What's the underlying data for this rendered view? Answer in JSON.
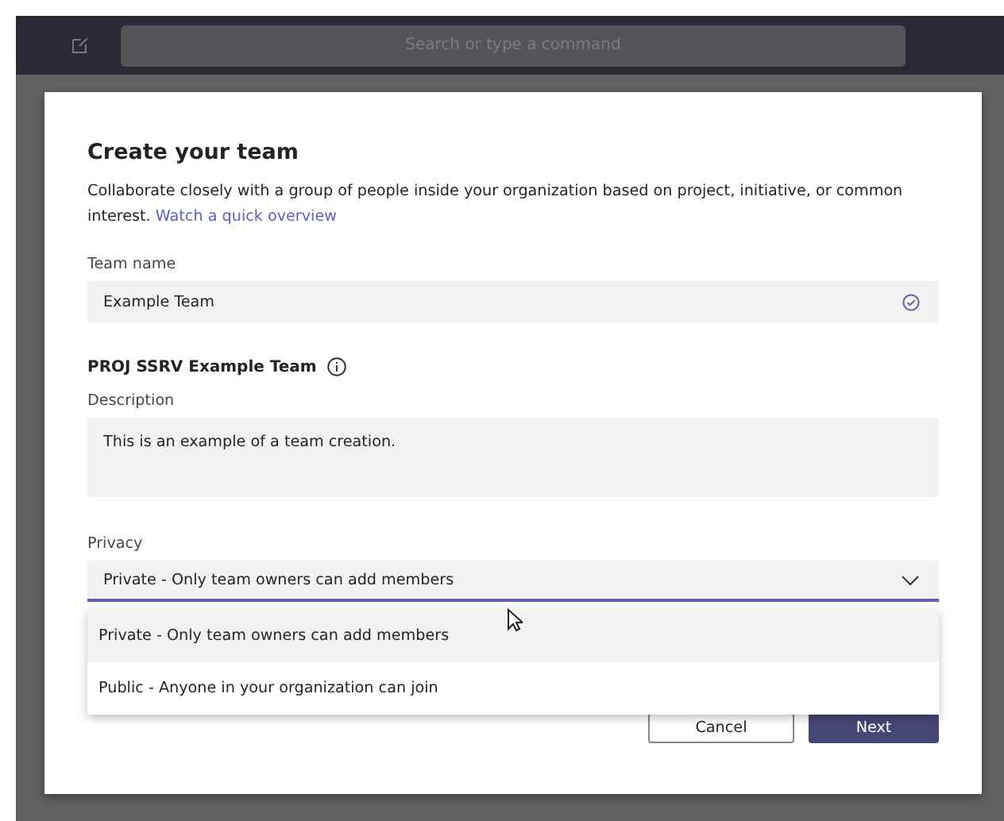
{
  "top_bar": {
    "search": {
      "placeholder": "Search or type a command"
    }
  },
  "dialog": {
    "title": "Create your team",
    "intro": "Collaborate closely with a group of people inside your organization based on project, initiative, or common interest.",
    "intro_link": "Watch a quick overview",
    "team_name": {
      "label": "Team name",
      "value": "Example Team",
      "valid": true
    },
    "classification": "PROJ SSRV Example Team",
    "description": {
      "label": "Description",
      "value": "This is an example of a team creation."
    },
    "privacy": {
      "label": "Privacy",
      "value": "Private - Only team owners can add members",
      "expanded": true,
      "options": [
        {
          "label": "Private - Only team owners can add members",
          "selected": true
        },
        {
          "label": "Public - Anyone in your organization can join",
          "selected": false
        }
      ]
    },
    "buttons": [
      {
        "label": "Cancel",
        "kind": "secondary"
      },
      {
        "label": "Next",
        "kind": "primary"
      }
    ]
  }
}
